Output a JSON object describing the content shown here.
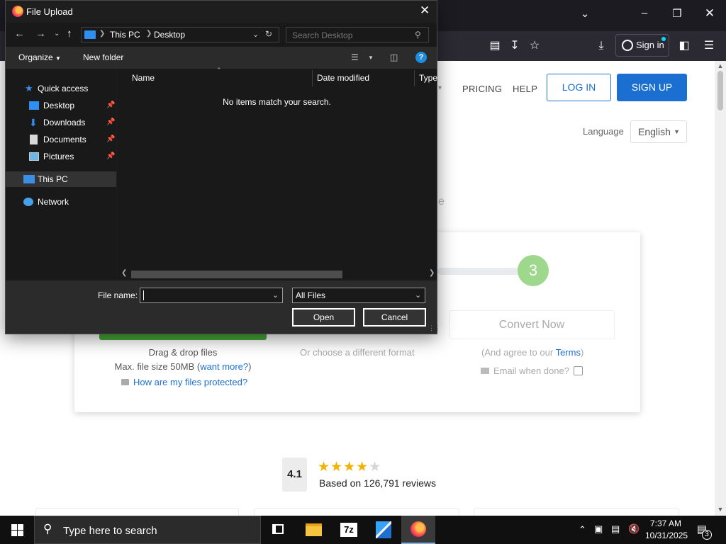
{
  "browser": {
    "signin_label": "Sign in",
    "window_controls": [
      "chevron-down-icon",
      "minimize-icon",
      "restore-icon",
      "close-icon"
    ],
    "toolbar_icons": [
      "reader-view-icon",
      "save-to-pocket-icon",
      "bookmark-star-icon",
      "download-icon",
      "extensions-icon",
      "menu-icon"
    ]
  },
  "page": {
    "nav": {
      "pricing": "PRICING",
      "help": "HELP",
      "login": "LOG IN",
      "signup": "SIGN UP"
    },
    "language": {
      "label": "Language",
      "selected": "English"
    },
    "faint_char": "e",
    "converter": {
      "step_number": "3",
      "convert_button": "Convert Now",
      "drag_drop": "Drag & drop files",
      "max_size_prefix": "Max. file size 50MB (",
      "want_more": "want more?",
      "max_size_suffix": ")",
      "protect_link": "How are my files protected?",
      "other_format": "Or choose a different format",
      "agree_prefix": "(And agree to our ",
      "terms": "Terms",
      "agree_suffix": ")",
      "email_label": "Email when done?"
    },
    "rating": {
      "score": "4.1",
      "stars_filled": 4,
      "stars_total": 5,
      "reviews": "Based on 126,791 reviews"
    }
  },
  "dialog": {
    "title": "File Upload",
    "address": {
      "segments": [
        "This PC",
        "Desktop"
      ]
    },
    "search_placeholder": "Search Desktop",
    "commands": {
      "organize": "Organize",
      "new_folder": "New folder"
    },
    "nav_items": [
      {
        "label": "Quick access",
        "icon": "star-icon"
      },
      {
        "label": "Desktop",
        "icon": "desktop-folder-icon",
        "pinned": true
      },
      {
        "label": "Downloads",
        "icon": "downloads-folder-icon",
        "pinned": true
      },
      {
        "label": "Documents",
        "icon": "documents-folder-icon",
        "pinned": true
      },
      {
        "label": "Pictures",
        "icon": "pictures-folder-icon",
        "pinned": true
      },
      {
        "label": "This PC",
        "icon": "this-pc-icon",
        "selected": true
      },
      {
        "label": "Network",
        "icon": "network-icon"
      }
    ],
    "columns": [
      "Name",
      "Date modified",
      "Type"
    ],
    "empty_message": "No items match your search.",
    "file_name_label": "File name:",
    "file_name_value": "",
    "file_type": "All Files",
    "open_button": "Open",
    "cancel_button": "Cancel"
  },
  "taskbar": {
    "search_placeholder": "Type here to search",
    "apps": [
      "task-view-icon",
      "file-explorer-icon",
      "7zip-icon",
      "media-app-icon",
      "firefox-icon"
    ],
    "time": "7:37 AM",
    "date": "10/31/2025",
    "notification_count": "3"
  }
}
